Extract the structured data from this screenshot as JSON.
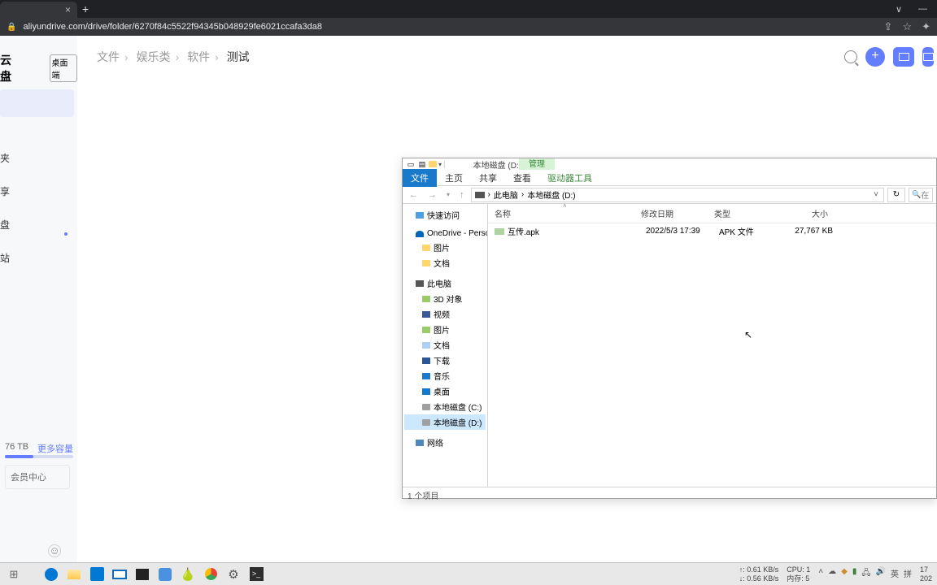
{
  "browser": {
    "url": "aliyundrive.com/drive/folder/6270f84c5522f94345b048929fe6021ccafa3da8"
  },
  "aliyun": {
    "brand": "云盘",
    "desktop_btn": "桌面端",
    "nav": {
      "fav": "夹",
      "share": "享",
      "drive": "盘",
      "recycle": "站"
    },
    "breadcrumb": [
      "文件",
      "娱乐类",
      "软件",
      "测试"
    ],
    "storage_text": "76 TB",
    "more_capacity": "更多容量",
    "member": "会员中心"
  },
  "explorer": {
    "manage_label": "管理",
    "title": "本地磁盘 (D:)",
    "ribbon": {
      "file": "文件",
      "home": "主页",
      "share": "共享",
      "view": "查看",
      "drive_tools": "驱动器工具"
    },
    "path": {
      "this_pc": "此电脑",
      "drive": "本地磁盘 (D:)"
    },
    "search_placeholder": "在",
    "tree": {
      "quick_access": "快速访问",
      "onedrive": "OneDrive - Persona",
      "pictures": "图片",
      "documents": "文档",
      "this_pc": "此电脑",
      "objects_3d": "3D 对象",
      "videos": "视频",
      "pics2": "图片",
      "docs2": "文档",
      "downloads": "下载",
      "music": "音乐",
      "desktop": "桌面",
      "drive_c": "本地磁盘 (C:)",
      "drive_d": "本地磁盘 (D:)",
      "network": "网络"
    },
    "columns": {
      "name": "名称",
      "date": "修改日期",
      "type": "类型",
      "size": "大小"
    },
    "file": {
      "name": "互传.apk",
      "date": "2022/5/3 17:39",
      "type": "APK 文件",
      "size": "27,767 KB"
    },
    "status": "1 个项目"
  },
  "taskbar": {
    "stats": {
      "up": "↑: 0.61 KB/s",
      "down": "↓: 0.56 KB/s",
      "cpu": "CPU: 1",
      "mem": "内存: 5"
    },
    "ime_en": "英",
    "ime_pin": "拼",
    "time1": "17",
    "time2": "202"
  }
}
